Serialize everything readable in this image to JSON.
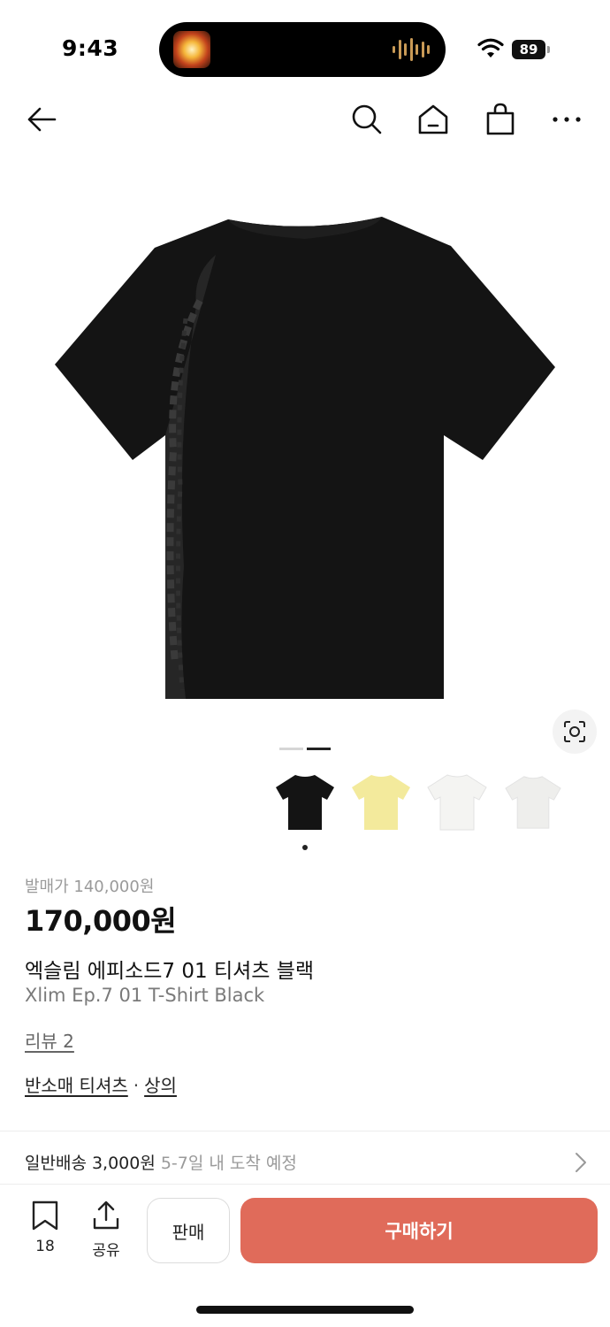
{
  "status_bar": {
    "time": "9:43",
    "battery": "89"
  },
  "product": {
    "release_price": "발매가 140,000원",
    "price": "170,000원",
    "name_ko": "엑슬림 에피소드7 01 티셔츠 블랙",
    "name_en": "Xlim Ep.7 01 T-Shirt Black",
    "review_link": "리뷰 2",
    "categories": [
      "반소매 티셔츠",
      "상의"
    ],
    "category_separator": "·",
    "image_pages": 2,
    "current_image_page": 2,
    "thumbnail_colors": [
      "#141414",
      "#f3ea9c",
      "#f4f4f2",
      "#eeeeec"
    ]
  },
  "shipping": {
    "label": "일반배송 3,000원",
    "eta": "5-7일 내 도착 예정"
  },
  "bottom_bar": {
    "bookmark_count": "18",
    "share_label": "공유",
    "sell_label": "판매",
    "buy_label": "구매하기"
  },
  "colors": {
    "buy_button": "#e06b5a",
    "text": "#111111",
    "muted": "#9a9a9a"
  }
}
